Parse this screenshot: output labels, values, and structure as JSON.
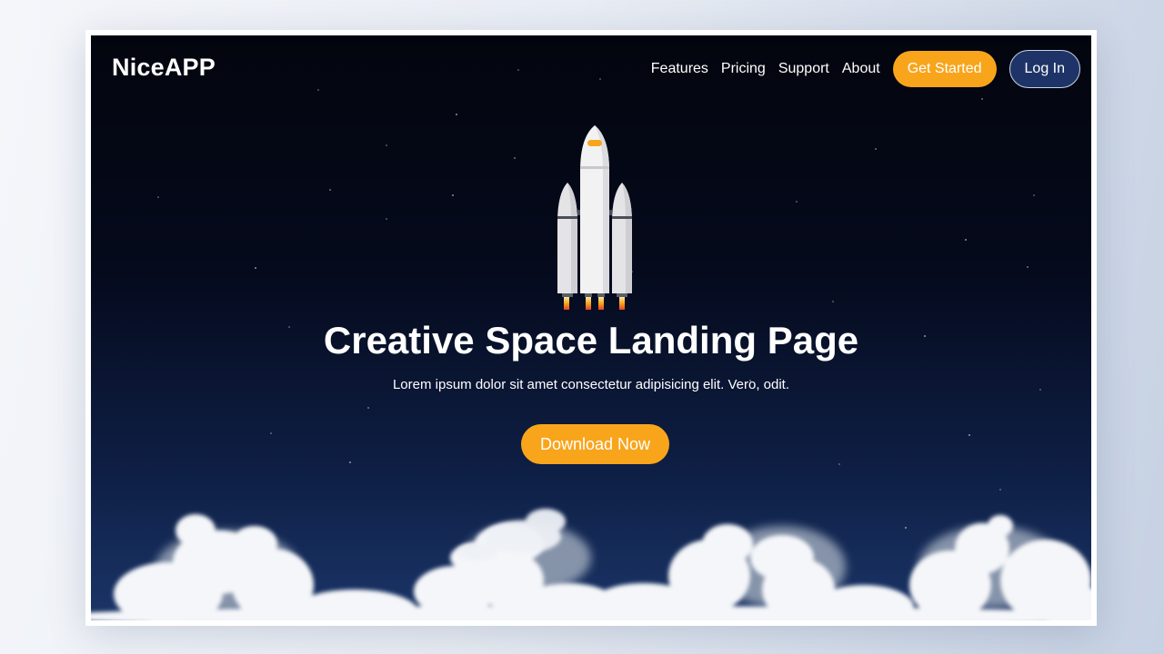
{
  "brand": {
    "name": "NiceAPP"
  },
  "nav": {
    "links": [
      "Features",
      "Pricing",
      "Support",
      "About"
    ],
    "get_started_label": "Get Started",
    "login_label": "Log In"
  },
  "hero": {
    "title": "Creative Space Landing Page",
    "subtitle": "Lorem ipsum dolor sit amet consectetur adipisicing elit. Vero, odit.",
    "cta_label": "Download Now"
  },
  "colors": {
    "accent": "#f8a51c",
    "login_button": "#1e3468",
    "sky_top": "#03050e",
    "sky_bottom": "#1b3568"
  },
  "icons": {
    "illustration": "rocket-icon",
    "background": "clouds-illustration"
  }
}
